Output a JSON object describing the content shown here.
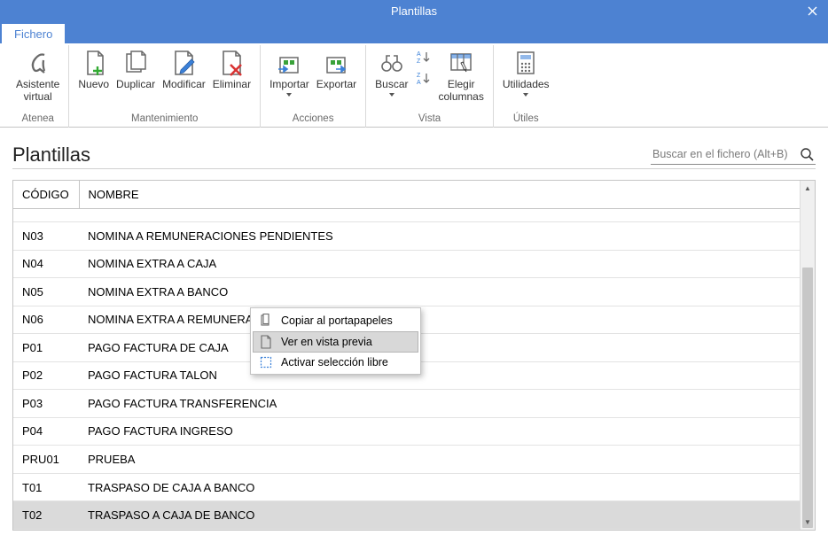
{
  "window": {
    "title": "Plantillas"
  },
  "tab": {
    "label": "Fichero"
  },
  "ribbon": {
    "groups": {
      "atenea": {
        "label": "Atenea",
        "assistant": "Asistente\nvirtual"
      },
      "mantenimiento": {
        "label": "Mantenimiento",
        "nuevo": "Nuevo",
        "duplicar": "Duplicar",
        "modificar": "Modificar",
        "eliminar": "Eliminar"
      },
      "acciones": {
        "label": "Acciones",
        "importar": "Importar",
        "exportar": "Exportar"
      },
      "vista": {
        "label": "Vista",
        "buscar": "Buscar",
        "elegir_columnas": "Elegir\ncolumnas"
      },
      "utiles": {
        "label": "Útiles",
        "utilidades": "Utilidades"
      }
    }
  },
  "page": {
    "title": "Plantillas",
    "search_placeholder": "Buscar en el fichero (Alt+B)"
  },
  "table": {
    "columns": {
      "codigo": "CÓDIGO",
      "nombre": "NOMBRE"
    },
    "rows": [
      {
        "codigo": "N03",
        "nombre": "NOMINA A REMUNERACIONES PENDIENTES"
      },
      {
        "codigo": "N04",
        "nombre": "NOMINA EXTRA A CAJA"
      },
      {
        "codigo": "N05",
        "nombre": "NOMINA EXTRA A BANCO"
      },
      {
        "codigo": "N06",
        "nombre": "NOMINA EXTRA A REMUNERACIONES PTES"
      },
      {
        "codigo": "P01",
        "nombre": "PAGO FACTURA DE CAJA"
      },
      {
        "codigo": "P02",
        "nombre": "PAGO FACTURA TALON"
      },
      {
        "codigo": "P03",
        "nombre": "PAGO FACTURA TRANSFERENCIA"
      },
      {
        "codigo": "P04",
        "nombre": "PAGO FACTURA INGRESO"
      },
      {
        "codigo": "PRU01",
        "nombre": "PRUEBA"
      },
      {
        "codigo": "T01",
        "nombre": "TRASPASO DE CAJA A BANCO"
      },
      {
        "codigo": "T02",
        "nombre": "TRASPASO A CAJA DE BANCO"
      }
    ],
    "selected_index": 10
  },
  "context_menu": {
    "items": [
      {
        "label": "Copiar al portapapeles"
      },
      {
        "label": "Ver en vista previa"
      },
      {
        "label": "Activar selección libre"
      }
    ],
    "highlighted_index": 1
  }
}
